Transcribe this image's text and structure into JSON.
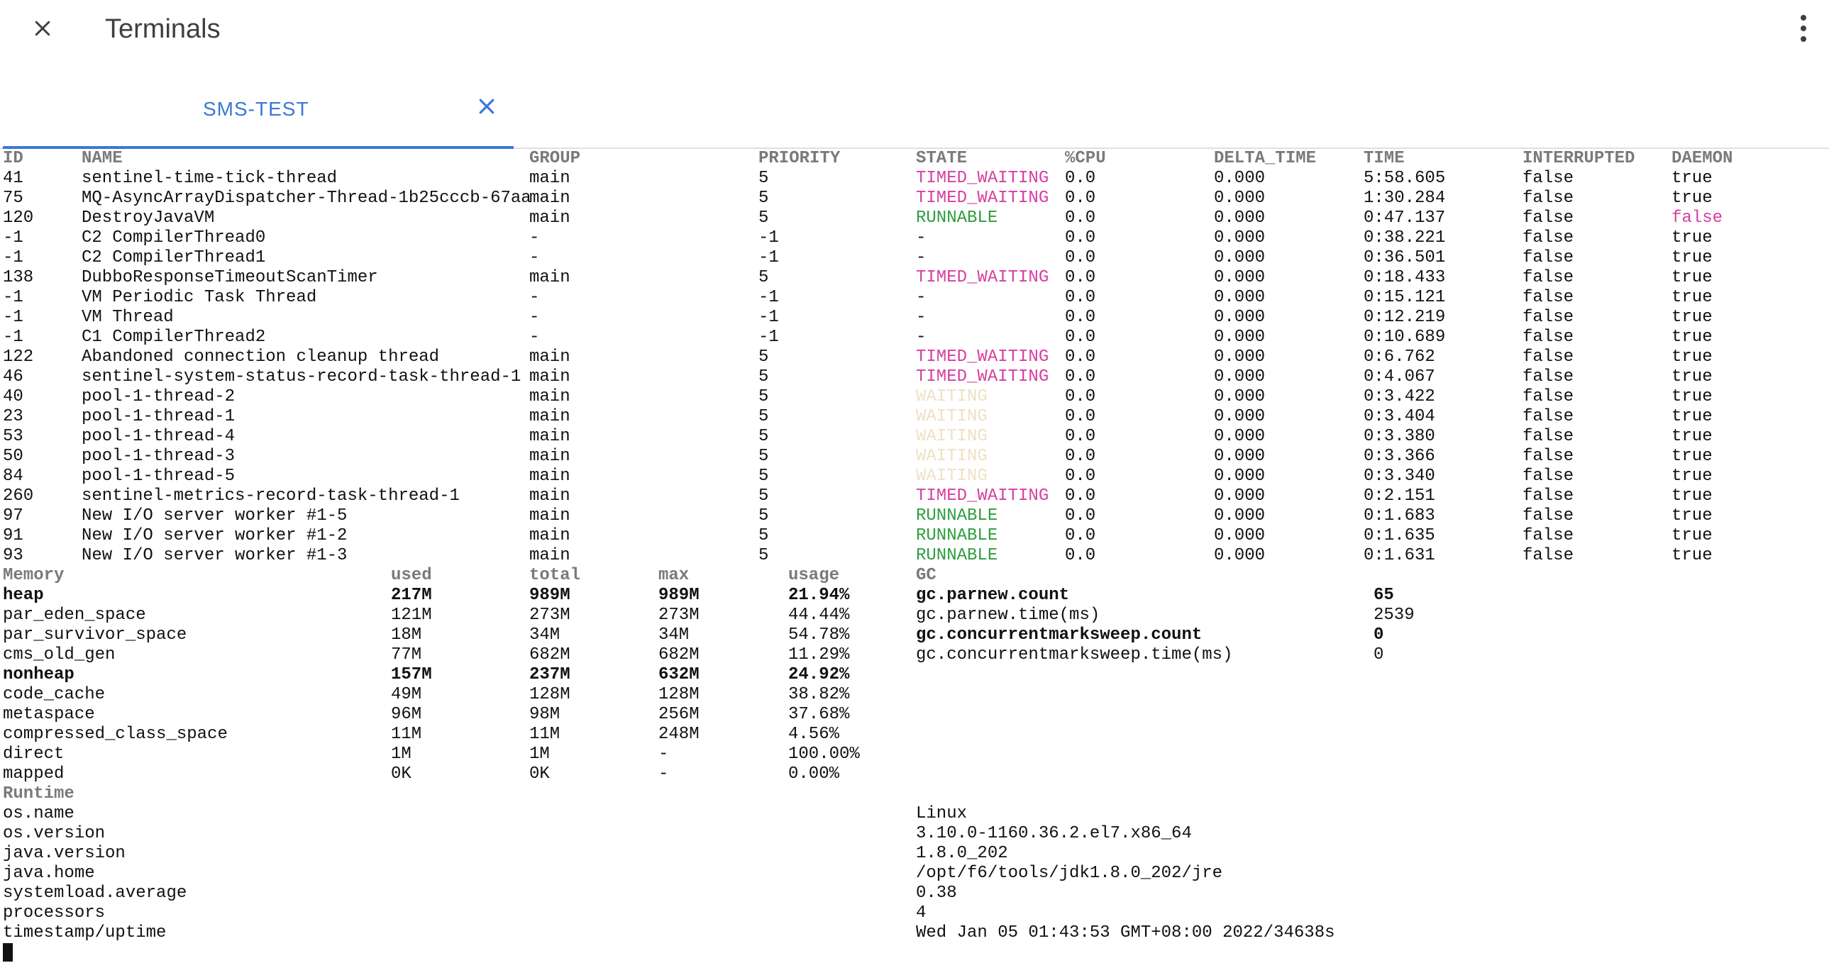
{
  "header": {
    "title": "Terminals"
  },
  "tabs": [
    {
      "label": "SMS-TEST"
    }
  ],
  "threads": {
    "columns": [
      "ID",
      "NAME",
      "GROUP",
      "PRIORITY",
      "STATE",
      "%CPU",
      "DELTA_TIME",
      "TIME",
      "INTERRUPTED",
      "DAEMON"
    ],
    "rows": [
      [
        "41",
        "sentinel-time-tick-thread",
        "main",
        "5",
        "TIMED_WAITING",
        "0.0",
        "0.000",
        "5:58.605",
        "false",
        "true"
      ],
      [
        "75",
        "MQ-AsyncArrayDispatcher-Thread-1b25cccb-67aa",
        "main",
        "5",
        "TIMED_WAITING",
        "0.0",
        "0.000",
        "1:30.284",
        "false",
        "true"
      ],
      [
        "120",
        "DestroyJavaVM",
        "main",
        "5",
        "RUNNABLE",
        "0.0",
        "0.000",
        "0:47.137",
        "false",
        "false"
      ],
      [
        "-1",
        "C2 CompilerThread0",
        "-",
        "-1",
        "-",
        "0.0",
        "0.000",
        "0:38.221",
        "false",
        "true"
      ],
      [
        "-1",
        "C2 CompilerThread1",
        "-",
        "-1",
        "-",
        "0.0",
        "0.000",
        "0:36.501",
        "false",
        "true"
      ],
      [
        "138",
        "DubboResponseTimeoutScanTimer",
        "main",
        "5",
        "TIMED_WAITING",
        "0.0",
        "0.000",
        "0:18.433",
        "false",
        "true"
      ],
      [
        "-1",
        "VM Periodic Task Thread",
        "-",
        "-1",
        "-",
        "0.0",
        "0.000",
        "0:15.121",
        "false",
        "true"
      ],
      [
        "-1",
        "VM Thread",
        "-",
        "-1",
        "-",
        "0.0",
        "0.000",
        "0:12.219",
        "false",
        "true"
      ],
      [
        "-1",
        "C1 CompilerThread2",
        "-",
        "-1",
        "-",
        "0.0",
        "0.000",
        "0:10.689",
        "false",
        "true"
      ],
      [
        "122",
        "Abandoned connection cleanup thread",
        "main",
        "5",
        "TIMED_WAITING",
        "0.0",
        "0.000",
        "0:6.762",
        "false",
        "true"
      ],
      [
        "46",
        "sentinel-system-status-record-task-thread-1",
        "main",
        "5",
        "TIMED_WAITING",
        "0.0",
        "0.000",
        "0:4.067",
        "false",
        "true"
      ],
      [
        "40",
        "pool-1-thread-2",
        "main",
        "5",
        "WAITING",
        "0.0",
        "0.000",
        "0:3.422",
        "false",
        "true"
      ],
      [
        "23",
        "pool-1-thread-1",
        "main",
        "5",
        "WAITING",
        "0.0",
        "0.000",
        "0:3.404",
        "false",
        "true"
      ],
      [
        "53",
        "pool-1-thread-4",
        "main",
        "5",
        "WAITING",
        "0.0",
        "0.000",
        "0:3.380",
        "false",
        "true"
      ],
      [
        "50",
        "pool-1-thread-3",
        "main",
        "5",
        "WAITING",
        "0.0",
        "0.000",
        "0:3.366",
        "false",
        "true"
      ],
      [
        "84",
        "pool-1-thread-5",
        "main",
        "5",
        "WAITING",
        "0.0",
        "0.000",
        "0:3.340",
        "false",
        "true"
      ],
      [
        "260",
        "sentinel-metrics-record-task-thread-1",
        "main",
        "5",
        "TIMED_WAITING",
        "0.0",
        "0.000",
        "0:2.151",
        "false",
        "true"
      ],
      [
        "97",
        "New I/O server worker #1-5",
        "main",
        "5",
        "RUNNABLE",
        "0.0",
        "0.000",
        "0:1.683",
        "false",
        "true"
      ],
      [
        "91",
        "New I/O server worker #1-2",
        "main",
        "5",
        "RUNNABLE",
        "0.0",
        "0.000",
        "0:1.635",
        "false",
        "true"
      ],
      [
        "93",
        "New I/O server worker #1-3",
        "main",
        "5",
        "RUNNABLE",
        "0.0",
        "0.000",
        "0:1.631",
        "false",
        "true"
      ]
    ]
  },
  "memory": {
    "columns": [
      "Memory",
      "used",
      "total",
      "max",
      "usage"
    ],
    "rows": [
      [
        "heap",
        "217M",
        "989M",
        "989M",
        "21.94%"
      ],
      [
        "par_eden_space",
        "121M",
        "273M",
        "273M",
        "44.44%"
      ],
      [
        "par_survivor_space",
        "18M",
        "34M",
        "34M",
        "54.78%"
      ],
      [
        "cms_old_gen",
        "77M",
        "682M",
        "682M",
        "11.29%"
      ],
      [
        "nonheap",
        "157M",
        "237M",
        "632M",
        "24.92%"
      ],
      [
        "code_cache",
        "49M",
        "128M",
        "128M",
        "38.82%"
      ],
      [
        "metaspace",
        "96M",
        "98M",
        "256M",
        "37.68%"
      ],
      [
        "compressed_class_space",
        "11M",
        "11M",
        "248M",
        "4.56%"
      ],
      [
        "direct",
        "1M",
        "1M",
        "-",
        "100.00%"
      ],
      [
        "mapped",
        "0K",
        "0K",
        "-",
        "0.00%"
      ]
    ],
    "bold_rows": [
      0,
      4
    ]
  },
  "gc": {
    "title": "GC",
    "rows": [
      [
        "gc.parnew.count",
        "65"
      ],
      [
        "gc.parnew.time(ms)",
        "2539"
      ],
      [
        "gc.concurrentmarksweep.count",
        "0"
      ],
      [
        "gc.concurrentmarksweep.time(ms)",
        "0"
      ]
    ],
    "bold_rows": [
      0,
      2
    ]
  },
  "runtime": {
    "title": "Runtime",
    "rows": [
      [
        "os.name",
        "Linux"
      ],
      [
        "os.version",
        "3.10.0-1160.36.2.el7.x86_64"
      ],
      [
        "java.version",
        "1.8.0_202"
      ],
      [
        "java.home",
        "/opt/f6/tools/jdk1.8.0_202/jre"
      ],
      [
        "systemload.average",
        "0.38"
      ],
      [
        "processors",
        "4"
      ],
      [
        "timestamp/uptime",
        "Wed Jan 05 01:43:53 GMT+08:00 2022/34638s"
      ]
    ]
  },
  "colors": {
    "accent": "#3c78d8",
    "timed_waiting": "#d6409f",
    "runnable": "#2e9e3e",
    "waiting": "#eee1c4"
  }
}
